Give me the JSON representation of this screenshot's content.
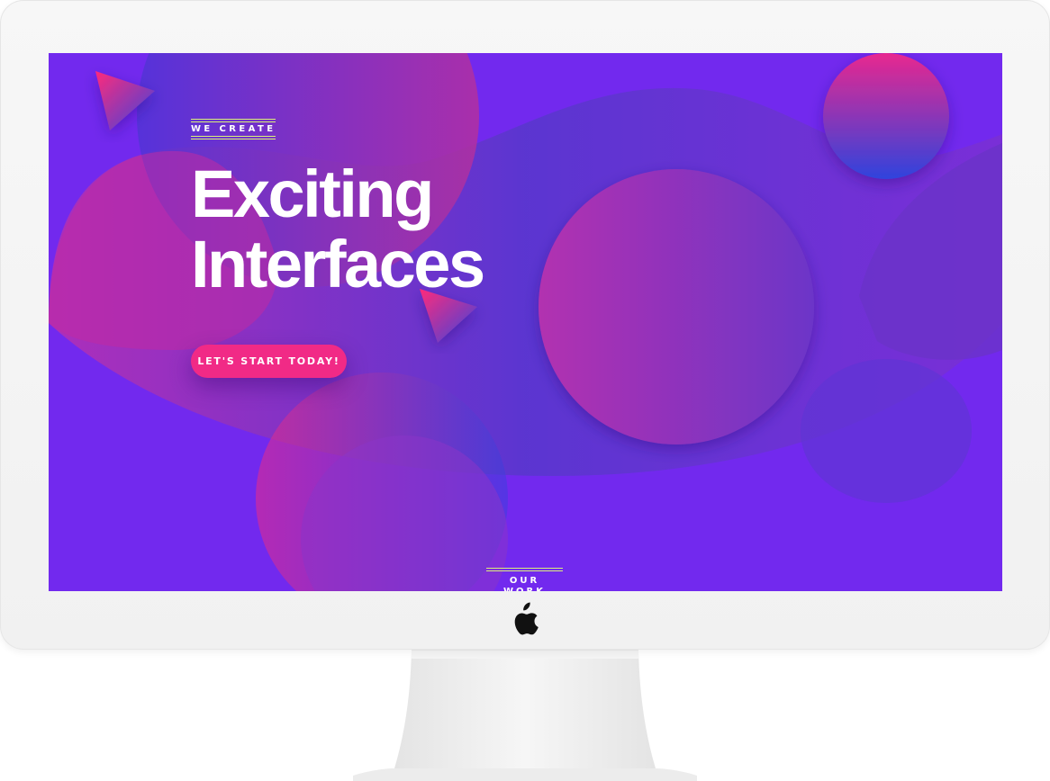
{
  "hero": {
    "eyebrow": "WE CREATE",
    "title_line1": "Exciting",
    "title_line2": "Interfaces",
    "cta_label": "LET'S START TODAY!"
  },
  "section": {
    "label": "OUR WORK"
  },
  "icons": {
    "brand_logo": "apple-logo-icon"
  },
  "colors": {
    "screen_background": "#7229ee",
    "accent_pink": "#f12a86",
    "accent_line": "#d9f07a",
    "text": "#ffffff"
  }
}
